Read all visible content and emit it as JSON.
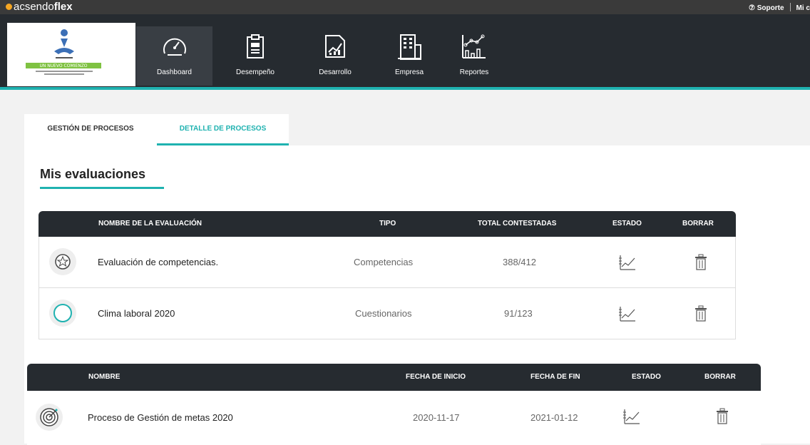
{
  "topbar": {
    "brand_light": "acsendo",
    "brand_bold": "flex",
    "support_label": "Soporte",
    "account_label": "Mi c"
  },
  "logo": {
    "banner_text": "UN NUEVO COMIENZO"
  },
  "nav": {
    "items": [
      {
        "label": "Dashboard",
        "icon": "speedometer-icon",
        "active": true
      },
      {
        "label": "Desempeño",
        "icon": "clipboard-icon",
        "active": false
      },
      {
        "label": "Desarrollo",
        "icon": "growth-chart-icon",
        "active": false
      },
      {
        "label": "Empresa",
        "icon": "building-icon",
        "active": false
      },
      {
        "label": "Reportes",
        "icon": "report-chart-icon",
        "active": false
      }
    ]
  },
  "tabs": [
    {
      "label": "GESTIÓN DE PROCESOS",
      "active": false
    },
    {
      "label": "DETALLE DE PROCESOS",
      "active": true
    }
  ],
  "section_title": "Mis evaluaciones",
  "evaluations": {
    "headers": {
      "name": "NOMBRE DE LA EVALUACIÓN",
      "type": "TIPO",
      "answered": "TOTAL CONTESTADAS",
      "status": "ESTADO",
      "delete": "BORRAR"
    },
    "rows": [
      {
        "icon": "star-icon",
        "name": "Evaluación de competencias.",
        "type": "Competencias",
        "answered": "388/412"
      },
      {
        "icon": "circle-icon",
        "name": "Clima laboral 2020",
        "type": "Cuestionarios",
        "answered": "91/123"
      }
    ]
  },
  "processes": {
    "headers": {
      "name": "NOMBRE",
      "start": "FECHA DE INICIO",
      "end": "FECHA DE FIN",
      "status": "ESTADO",
      "delete": "BORRAR"
    },
    "rows": [
      {
        "icon": "target-icon",
        "name": "Proceso de Gestión de metas 2020",
        "start": "2020-11-17",
        "end": "2021-01-12"
      }
    ]
  },
  "colors": {
    "accent": "#1fb2b0",
    "nav_bg": "#262b30",
    "brand_dot": "#f5a623"
  }
}
